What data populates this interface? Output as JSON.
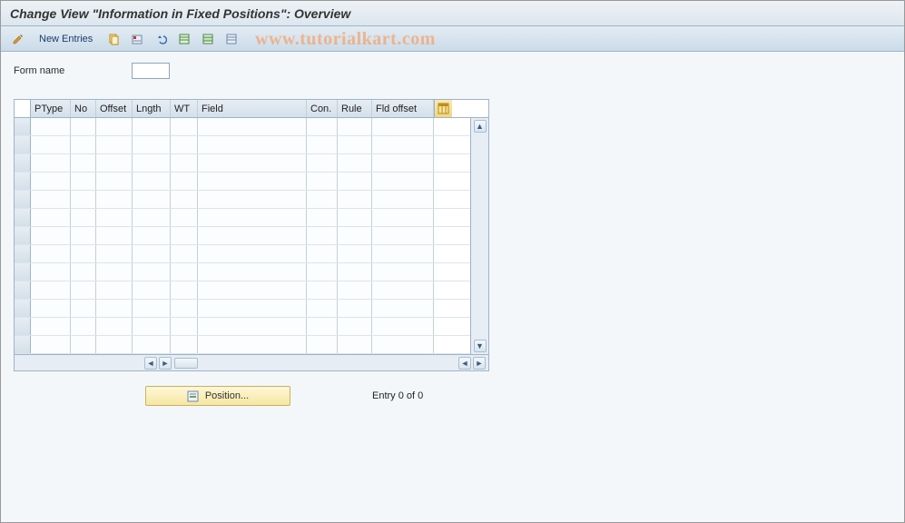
{
  "title": "Change View \"Information in Fixed Positions\": Overview",
  "watermark": "www.tutorialkart.com",
  "toolbar": {
    "new_entries": "New Entries",
    "icons": {
      "edit": "pencil-icon",
      "copy": "copy-icon",
      "delete": "delete-icon",
      "undo": "undo-icon",
      "select_all": "select-all-icon",
      "select_block": "select-block-icon",
      "deselect": "deselect-icon"
    }
  },
  "form": {
    "name_label": "Form name",
    "name_value": ""
  },
  "grid": {
    "columns": {
      "ptype": "PType",
      "no": "No",
      "offset": "Offset",
      "lngth": "Lngth",
      "wt": "WT",
      "field": "Field",
      "con": "Con.",
      "rule": "Rule",
      "fldoff": "Fld offset"
    },
    "row_count": 13
  },
  "position_button": "Position...",
  "entry_status": "Entry 0 of 0"
}
